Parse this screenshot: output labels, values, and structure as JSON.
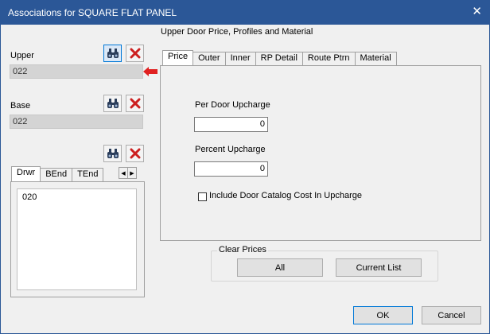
{
  "window": {
    "title": "Associations for SQUARE FLAT PANEL",
    "close_glyph": "✕"
  },
  "section_title": "Upper Door Price, Profiles and Material",
  "upper": {
    "label": "Upper",
    "value": "022"
  },
  "base": {
    "label": "Base",
    "value": "022"
  },
  "drawer_tabs": [
    "Drwr",
    "BEnd",
    "TEnd"
  ],
  "drawer_list": [
    "020"
  ],
  "main_tabs": [
    "Price",
    "Outer",
    "Inner",
    "RP Detail",
    "Route Ptrn",
    "Material"
  ],
  "price": {
    "per_door_label": "Per Door Upcharge",
    "per_door_value": "0",
    "percent_label": "Percent Upcharge",
    "percent_value": "0",
    "include_label": "Include Door Catalog Cost In Upcharge",
    "include_checked": false
  },
  "clear_prices": {
    "legend": "Clear Prices",
    "all_label": "All",
    "current_list_label": "Current List"
  },
  "footer": {
    "ok_label": "OK",
    "cancel_label": "Cancel"
  },
  "colors": {
    "titlebar": "#2b5797",
    "delete_red": "#cc1f1f",
    "arrow_red": "#e02020"
  },
  "icons": [
    "binoculars-icon",
    "delete-x-icon",
    "arrow-left-icon",
    "scroll-left-icon",
    "scroll-right-icon"
  ]
}
